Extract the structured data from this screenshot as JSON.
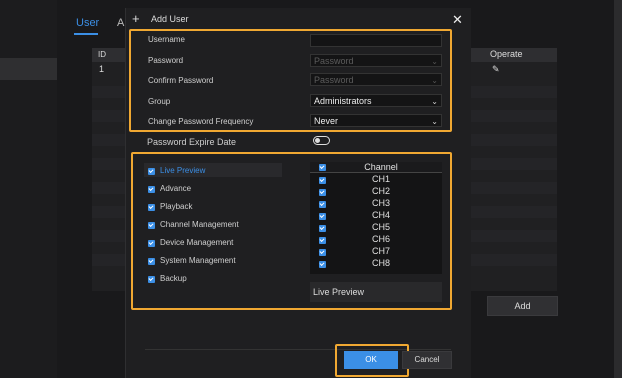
{
  "tabs": {
    "user": "User",
    "partial": "A"
  },
  "background_table": {
    "columns": [
      "ID",
      "Operate"
    ],
    "rows": [
      {
        "id": "1"
      }
    ],
    "add_label": "Add"
  },
  "dialog": {
    "title": "Add User",
    "fields": {
      "username": {
        "label": "Username",
        "value": ""
      },
      "password": {
        "label": "Password",
        "placeholder": "Password"
      },
      "confirm_password": {
        "label": "Confirm Password",
        "placeholder": "Password"
      },
      "group": {
        "label": "Group",
        "value": "Administrators"
      },
      "change_password_frequency": {
        "label": "Change Password Frequency",
        "value": "Never"
      },
      "password_expire_date": {
        "label": "Password Expire Date",
        "enabled": false
      }
    },
    "permissions": [
      {
        "label": "Live Preview",
        "checked": true,
        "active": true
      },
      {
        "label": "Advance",
        "checked": true
      },
      {
        "label": "Playback",
        "checked": true
      },
      {
        "label": "Channel Management",
        "checked": true
      },
      {
        "label": "Device Management",
        "checked": true
      },
      {
        "label": "System Management",
        "checked": true
      },
      {
        "label": "Backup",
        "checked": true
      }
    ],
    "channels": {
      "header": "Channel",
      "items": [
        "CH1",
        "CH2",
        "CH3",
        "CH4",
        "CH5",
        "CH6",
        "CH7",
        "CH8"
      ],
      "footer": "Live Preview"
    },
    "buttons": {
      "ok": "OK",
      "cancel": "Cancel"
    }
  },
  "colors": {
    "accent": "#3b8fe6",
    "highlight": "#f0a832",
    "background": "#19191b"
  },
  "icons": [
    "plus-icon",
    "close-icon",
    "chevron-down-icon",
    "edit-icon",
    "checkbox-checked-icon",
    "toggle-off-icon"
  ]
}
